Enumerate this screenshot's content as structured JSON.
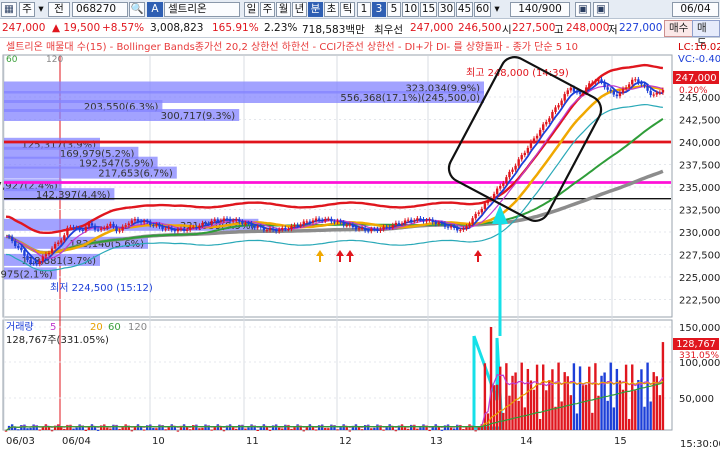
{
  "toolbar": {
    "items": [
      {
        "label": "▦",
        "icon": "grid-icon"
      },
      {
        "label": "주"
      },
      {
        "label": "▾",
        "icon": "dropdown-arrow-icon"
      },
      {
        "label": "전"
      },
      {
        "label": "068270"
      },
      {
        "label": "🔍",
        "icon": "search-icon"
      },
      {
        "label": "A"
      },
      {
        "label": "셀트리온"
      },
      {
        "label": "일"
      },
      {
        "label": "주"
      },
      {
        "label": "월"
      },
      {
        "label": "년"
      },
      {
        "label": "분"
      },
      {
        "label": "초"
      },
      {
        "label": "틱"
      },
      {
        "label": "1"
      },
      {
        "label": "3"
      },
      {
        "label": "5"
      },
      {
        "label": "10"
      },
      {
        "label": "15"
      },
      {
        "label": "30"
      },
      {
        "label": "45"
      },
      {
        "label": "60"
      },
      {
        "label": "▾",
        "icon": "dropdown-arrow-icon"
      },
      {
        "label": "140/900"
      },
      {
        "label": "▣",
        "icon": "grid-icon"
      },
      {
        "label": "▣",
        "icon": "compare-icon"
      },
      {
        "label": "06/04",
        "icon": "calendar-icon"
      }
    ],
    "active_index": 16
  },
  "quote": {
    "price": "247,000",
    "change": "▲ 19,500",
    "change_rate": "+8.57%",
    "volume": "3,008,823",
    "volume_ratio": "165.91%",
    "turnover_rate": "2.23%",
    "trade_value": "718,583백만",
    "best_ask_label": "최우선",
    "best_ask": "247,000",
    "best_bid": "246,500",
    "open_label": "시",
    "open": "227,500",
    "high_label": "고",
    "high": "248,000",
    "low_label": "저",
    "low": "227,000",
    "buy_label": "매수",
    "sell_label": "매도"
  },
  "colors": {
    "up": "#e0161e",
    "down": "#1c3fd8",
    "volume_profile": "#8383ff",
    "hline_red": "#e0141c",
    "hline_magenta": "#ff10d8",
    "hline_black": "#111111",
    "annotation_cyan": "#16e0e8"
  },
  "chart_data": [
    {
      "type": "candlestick",
      "legend_text": "셀트리온 매물대 수(15) - Bollinger Bands종가선 20,2 상한선 하한선 - CCI가준선 상한선 - DI+가 DI- 를 상향돌파 - 종가 단순 5 10",
      "legend_right": [
        "LC:10.02",
        "VC:-0.40"
      ],
      "ma_periods": [
        "5",
        "20",
        "60",
        "120"
      ],
      "y_ticks": [
        "247,000",
        "245,000",
        "242,500",
        "240,000",
        "237,500",
        "235,000",
        "232,500",
        "230,000",
        "227,500",
        "225,000",
        "222,500"
      ],
      "current_price_label": "247,000",
      "current_change_label": "0.20%",
      "x_ticks": [
        "06/03",
        "06/04",
        "10",
        "11",
        "12",
        "13",
        "14",
        "15"
      ],
      "time_label": "15:30:00",
      "volume_profile": [
        {
          "label": "323,034(9.9%)",
          "price": 246000,
          "ratio": 1.0
        },
        {
          "label": "556,368(17.1%)(245,500,0)",
          "price": 245000,
          "ratio": 1.0
        },
        {
          "label": "203,550(6.3%)",
          "price": 244000,
          "ratio": 0.33
        },
        {
          "label": "300,717(9.3%)",
          "price": 243000,
          "ratio": 0.49
        },
        {
          "label": "125,317(3.9%)",
          "price": 239800,
          "ratio": 0.2
        },
        {
          "label": "169,979(5.2%)",
          "price": 238800,
          "ratio": 0.28
        },
        {
          "label": "192,547(5.9%)",
          "price": 237700,
          "ratio": 0.32
        },
        {
          "label": "217,653(6.7%)",
          "price": 236600,
          "ratio": 0.36
        },
        {
          "label": "77,927(2.4%)",
          "price": 235200,
          "ratio": 0.12
        },
        {
          "label": "142,397(4.4%)",
          "price": 234200,
          "ratio": 0.23
        },
        {
          "label": "321,959(9.9%)",
          "price": 230800,
          "ratio": 0.53
        },
        {
          "label": "183,140(5.6%)",
          "price": 228800,
          "ratio": 0.3
        },
        {
          "label": "118,881(3.7%)",
          "price": 226900,
          "ratio": 0.2
        },
        {
          "label": "68,975(2.1%)",
          "price": 225400,
          "ratio": 0.11
        }
      ],
      "horizontal_lines": [
        {
          "price": 240000,
          "color": "hline_red"
        },
        {
          "price": 235500,
          "color": "hline_magenta"
        },
        {
          "price": 233700,
          "color": "hline_black"
        }
      ],
      "annotations": {
        "high": "최고 248,000 (14:39)",
        "low": "최저 224,500 (15:12)"
      }
    },
    {
      "type": "bar",
      "title": "거래량",
      "ma_periods": [
        "5",
        "20",
        "60",
        "120"
      ],
      "summary": "128,767주(331.05%)",
      "y_ticks": [
        "150,000",
        "100,000",
        "50,000"
      ],
      "current_label": "128,767",
      "current_ratio": "331.05%"
    }
  ]
}
